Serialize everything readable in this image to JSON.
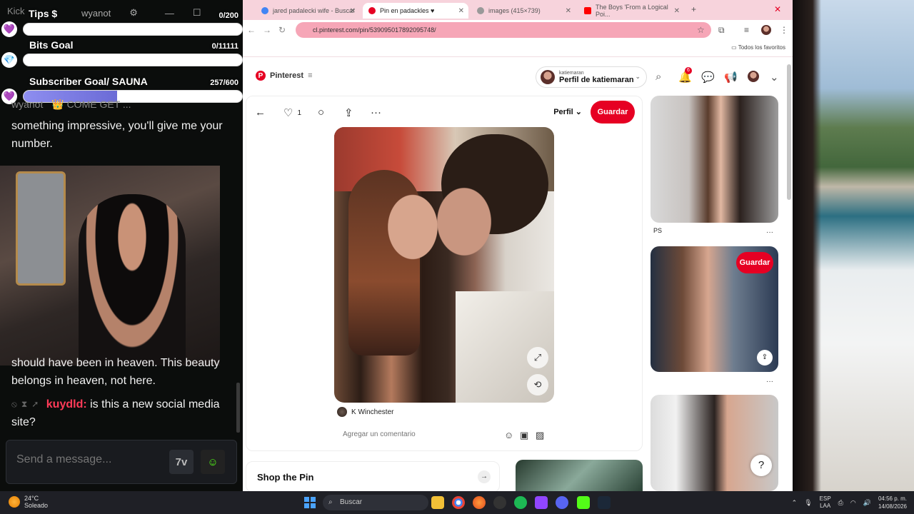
{
  "overlay": {
    "platform_label": "Kick",
    "tips_label": "Tips $",
    "channel_name": "wyanot",
    "tips_count": "0/200",
    "tips_progress": 0,
    "bits_label": "Bits Goal",
    "bits_count": "0/11111",
    "bits_progress": 0,
    "sub_label": "Subscriber Goal/ SAUNA",
    "sub_count": "257/600",
    "sub_progress": 0.428,
    "pinned_user": "wyanot",
    "pinned_text": "👑 COME GET ..."
  },
  "chat": {
    "messages": [
      {
        "user": "",
        "text": "something impressive, you'll give me your number."
      },
      {
        "user": "",
        "text": "should have been in heaven. This beauty belongs in heaven, not here."
      },
      {
        "user": "kuydld:",
        "text": "is this a new social media site?"
      }
    ],
    "input_placeholder": "Send a message...",
    "emote_label": "7v"
  },
  "browser": {
    "tabs": [
      {
        "title": "jared padalecki wife - Buscar",
        "color": "#4285f4",
        "active": false
      },
      {
        "title": "Pin en padackles ♥",
        "color": "#e60023",
        "active": true
      },
      {
        "title": "images (415×739)",
        "color": "#999999",
        "active": false
      },
      {
        "title": "The Boys 'From a Logical Poi...",
        "color": "#ff0000",
        "active": false
      }
    ],
    "url": "cl.pinterest.com/pin/539095017892095748/",
    "bookmarks_label": "Todos los favoritos"
  },
  "pinterest": {
    "logo": "Pinterest",
    "profile_sub": "katiemaran",
    "profile_main": "Perfil de katiemaran",
    "notification_count": "6",
    "like_count": "1",
    "board_dropdown": "Perfil",
    "save_label": "Guardar",
    "author": "K Winchester",
    "comment_placeholder": "Agregar un comentario",
    "shop_title": "Shop the Pin",
    "related_caption": "PS",
    "related_save_label": "Guardar",
    "help": "?"
  },
  "taskbar": {
    "temperature": "24°C",
    "weather": "Soleado",
    "search_label": "Buscar",
    "lang_top": "ESP",
    "lang_bottom": "LAA",
    "time": "04:56 p. m.",
    "date": "14/08/2026"
  }
}
